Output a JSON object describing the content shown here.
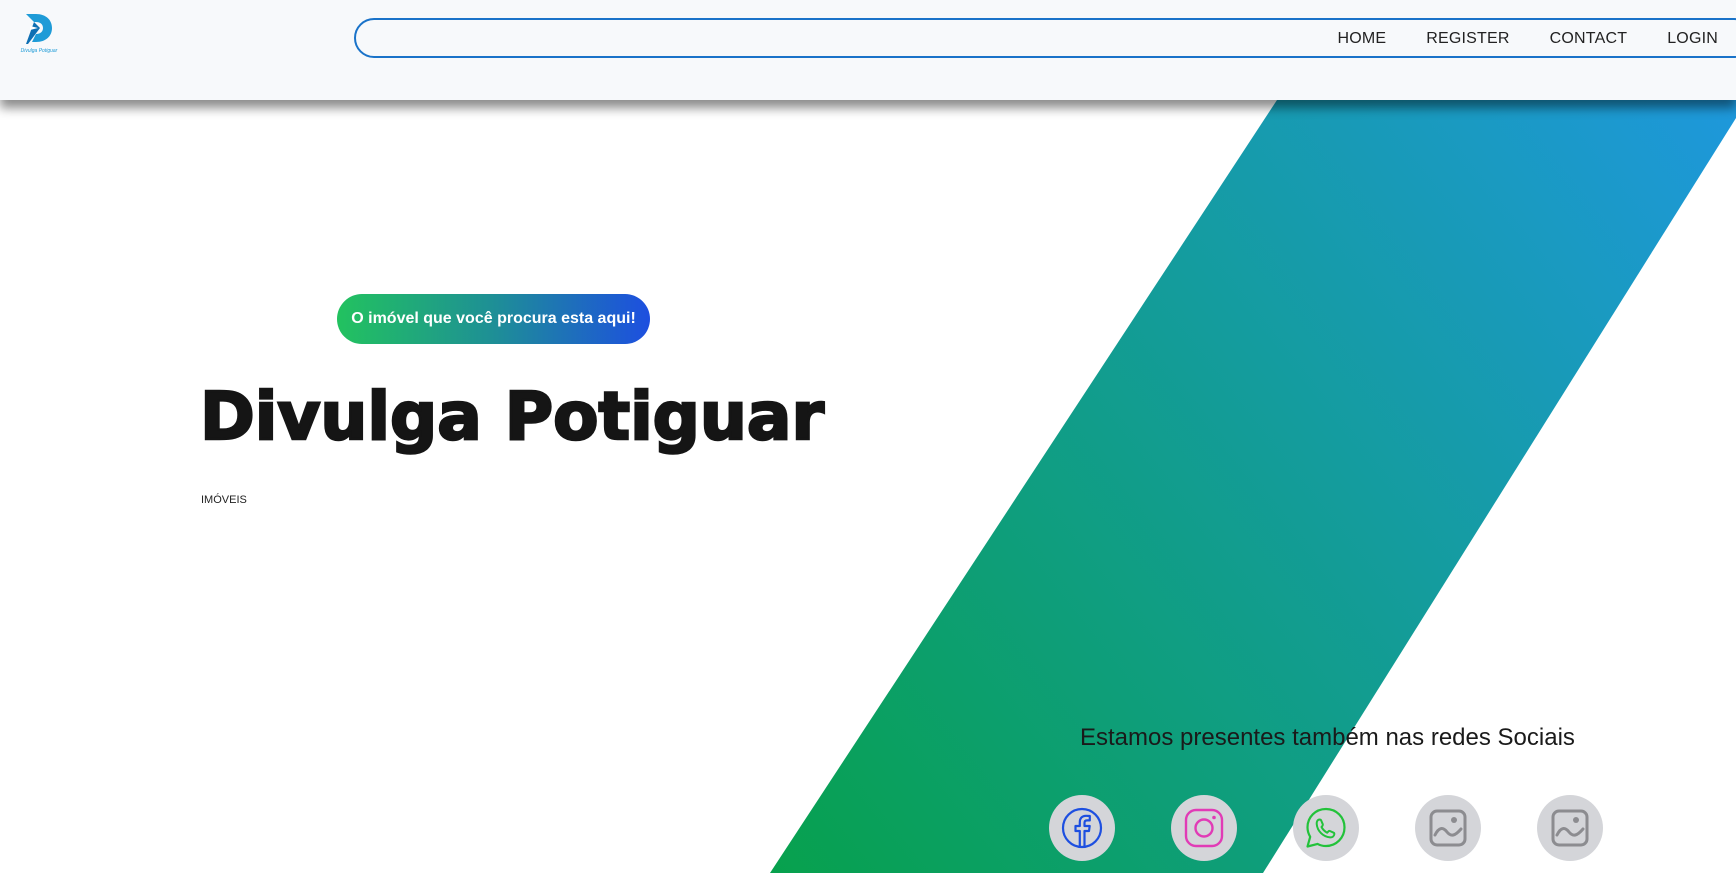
{
  "header": {
    "logo_text": "Divulga Potiguar",
    "nav": [
      "HOME",
      "REGISTER",
      "CONTACT",
      "LOGIN"
    ]
  },
  "hero": {
    "badge": "O imóvel que você procura esta aqui!",
    "title": "Divulga Potiguar",
    "subtitle": "IMÓVEIS"
  },
  "social": {
    "title": "Estamos presentes também nas redes Sociais",
    "icons": [
      "facebook-icon",
      "instagram-icon",
      "whatsapp-icon",
      "image-placeholder-icon",
      "image-placeholder-icon"
    ]
  },
  "colors": {
    "accent_blue": "#1a73c9",
    "stripe_top": "#1e98dc",
    "stripe_bottom": "#07a14c",
    "facebook": "#1d4fe0",
    "instagram": "#e13bb6",
    "whatsapp": "#22c23a"
  }
}
